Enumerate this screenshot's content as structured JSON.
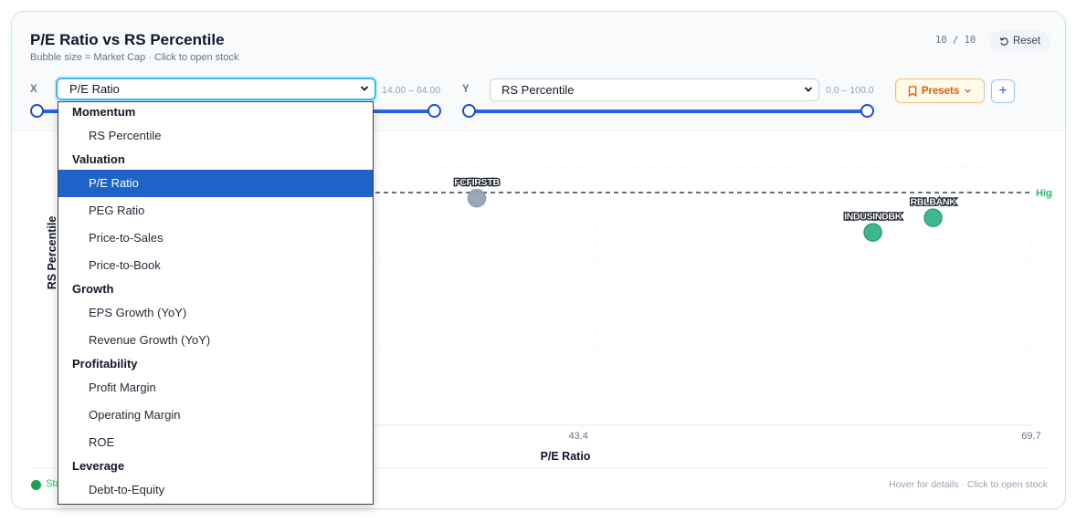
{
  "header": {
    "title": "P/E Ratio vs RS Percentile",
    "subtitle": "Bubble size = Market Cap · Click to open stock",
    "count": "10 / 10",
    "reset_label": "Reset"
  },
  "controls": {
    "x_tag": "X",
    "y_tag": "Y",
    "x_selected": "P/E Ratio",
    "y_selected": "RS Percentile",
    "x_range_text": "14.00 – 64.00",
    "y_range_text": "0.0 – 100.0",
    "presets_label": "Presets",
    "add_label": "+"
  },
  "dropdown": {
    "groups": [
      {
        "label": "Momentum",
        "options": [
          "RS Percentile"
        ]
      },
      {
        "label": "Valuation",
        "options": [
          "P/E Ratio",
          "PEG Ratio",
          "Price-to-Sales",
          "Price-to-Book"
        ]
      },
      {
        "label": "Growth",
        "options": [
          "EPS Growth (YoY)",
          "Revenue Growth (YoY)"
        ]
      },
      {
        "label": "Profitability",
        "options": [
          "Profit Margin",
          "Operating Margin",
          "ROE"
        ]
      },
      {
        "label": "Leverage",
        "options": [
          "Debt-to-Equity"
        ]
      }
    ],
    "selected": "P/E Ratio"
  },
  "chart_data": {
    "type": "scatter",
    "xlabel": "P/E Ratio",
    "ylabel": "RS Percentile",
    "x_ticks": [
      "43.4",
      "69.7"
    ],
    "reference_line_label": "Hig",
    "points": [
      {
        "label": "FCFIRSTB",
        "x": 37.5,
        "y": 88,
        "color": "#94a3b8"
      },
      {
        "label": "INDUSINDBK",
        "x": 60.5,
        "y": 74,
        "color": "#34b38a"
      },
      {
        "label": "RBLBANK",
        "x": 64.0,
        "y": 80,
        "color": "#34b38a"
      }
    ]
  },
  "footer": {
    "legend_text": "Sta",
    "hint": "Hover for details · Click to open stock"
  },
  "colors": {
    "accent": "#2563eb",
    "highlight_line": "#334155",
    "positive": "#34b38a",
    "neutral": "#94a3b8",
    "presets": "#ea580c"
  }
}
